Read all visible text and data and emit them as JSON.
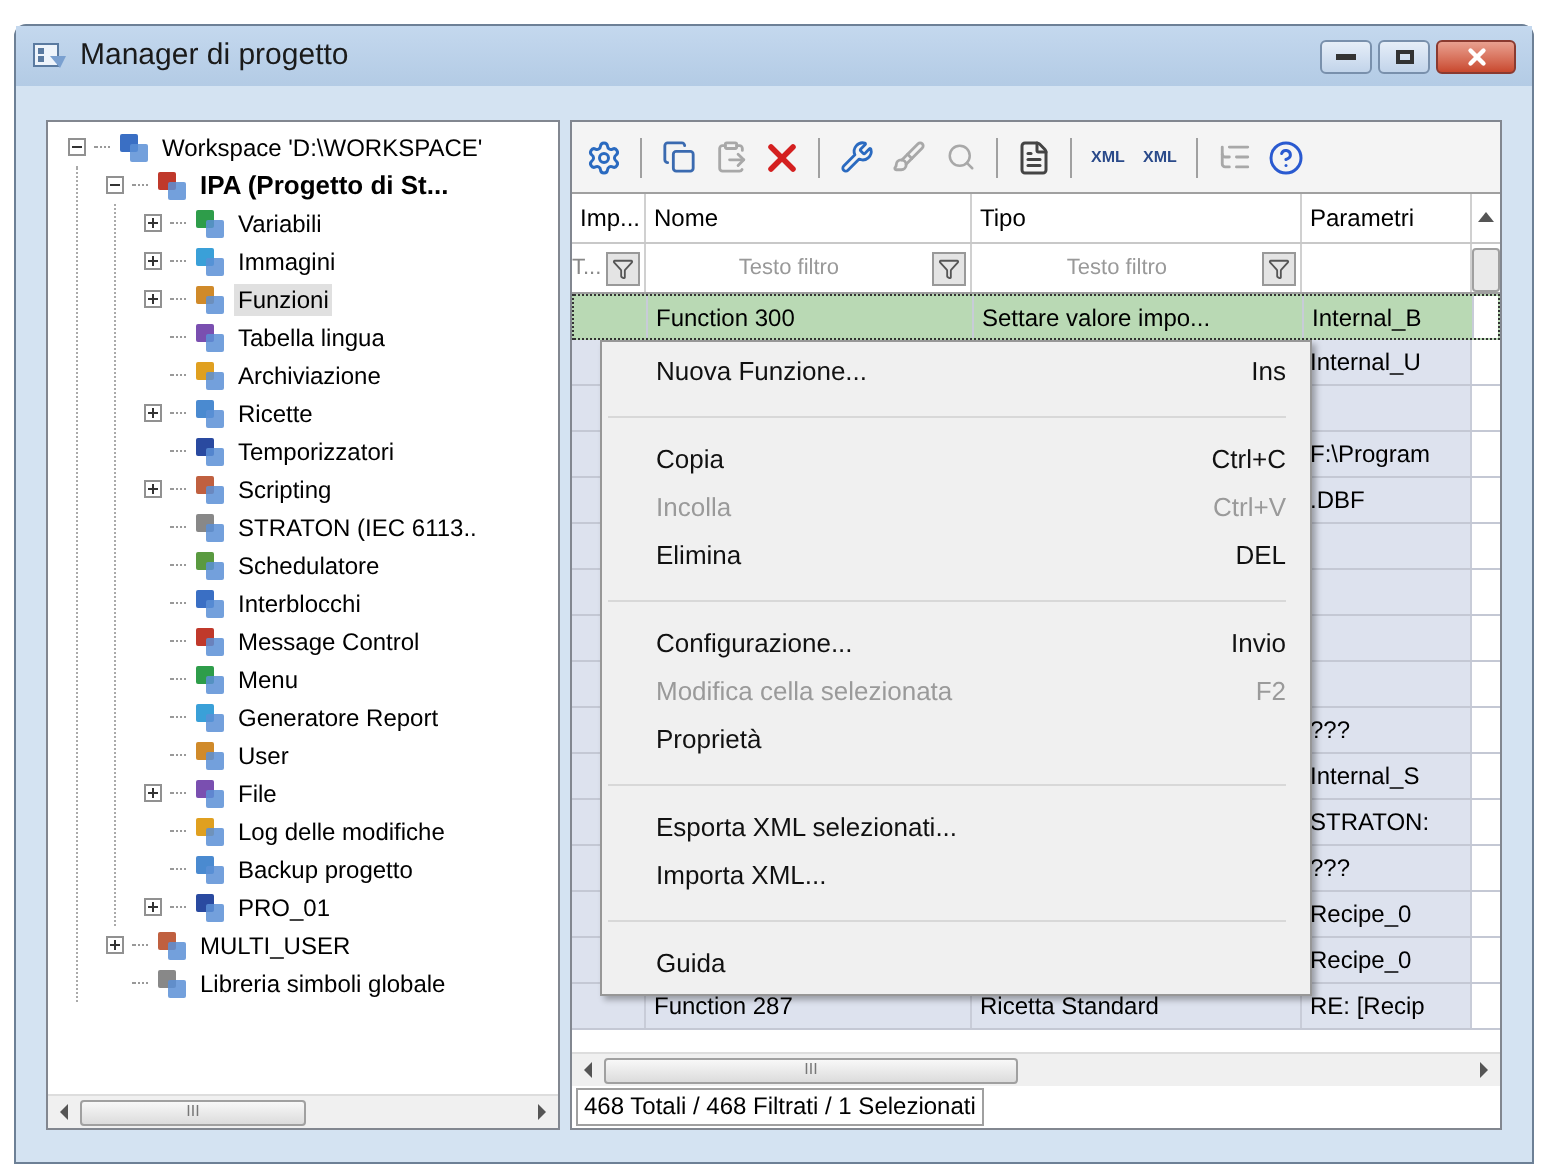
{
  "window": {
    "title": "Manager di progetto"
  },
  "tree": [
    {
      "label": "Workspace 'D:\\WORKSPACE'",
      "expanded": true,
      "selected": false,
      "children": [
        {
          "label": "IPA (Progetto di St...",
          "bold": true,
          "expanded": true,
          "selected": false,
          "children": [
            {
              "label": "Variabili",
              "expanded": false,
              "selected": false
            },
            {
              "label": "Immagini",
              "expanded": false,
              "selected": false
            },
            {
              "label": "Funzioni",
              "expanded": false,
              "selected": true
            },
            {
              "label": "Tabella lingua",
              "selected": false
            },
            {
              "label": "Archiviazione",
              "selected": false
            },
            {
              "label": "Ricette",
              "expanded": false,
              "selected": false
            },
            {
              "label": "Temporizzatori",
              "selected": false
            },
            {
              "label": "Scripting",
              "expanded": false,
              "selected": false
            },
            {
              "label": "STRATON (IEC 6113..",
              "selected": false
            },
            {
              "label": "Schedulatore",
              "selected": false
            },
            {
              "label": "Interblocchi",
              "selected": false
            },
            {
              "label": "Message Control",
              "selected": false
            },
            {
              "label": "Menu",
              "selected": false
            },
            {
              "label": "Generatore Report",
              "selected": false
            },
            {
              "label": "User",
              "selected": false
            },
            {
              "label": "File",
              "expanded": false,
              "selected": false
            },
            {
              "label": "Log delle modifiche",
              "selected": false
            },
            {
              "label": "Backup progetto",
              "selected": false
            },
            {
              "label": "PRO_01",
              "expanded": false,
              "selected": false
            }
          ]
        },
        {
          "label": "MULTI_USER",
          "expanded": false,
          "selected": false
        },
        {
          "label": "Libreria simboli globale",
          "selected": false
        }
      ]
    }
  ],
  "tree_scrollbar": {
    "thumb": "III"
  },
  "toolbar": [
    {
      "kind": "new",
      "disabled": false
    },
    {
      "kind": "separator"
    },
    {
      "kind": "copy",
      "disabled": false
    },
    {
      "kind": "paste",
      "disabled": true
    },
    {
      "kind": "delete",
      "disabled": false
    },
    {
      "kind": "separator"
    },
    {
      "kind": "wrench",
      "disabled": false
    },
    {
      "kind": "brush",
      "disabled": true
    },
    {
      "kind": "find",
      "disabled": true
    },
    {
      "kind": "separator"
    },
    {
      "kind": "properties",
      "disabled": false
    },
    {
      "kind": "separator"
    },
    {
      "kind": "export",
      "label": "XML",
      "disabled": false
    },
    {
      "kind": "import",
      "label": "XML",
      "disabled": false
    },
    {
      "kind": "separator"
    },
    {
      "kind": "tree",
      "disabled": true
    },
    {
      "kind": "help",
      "disabled": false
    }
  ],
  "table": {
    "columns": [
      {
        "label": "Imp...",
        "filter": "T...",
        "funnel": true
      },
      {
        "label": "Nome",
        "placeholder": "Testo filtro",
        "funnel": true
      },
      {
        "label": "Tipo",
        "placeholder": "Testo filtro",
        "funnel": true
      },
      {
        "label": "Parametri"
      }
    ],
    "rows": [
      {
        "selected": true,
        "nome": "Function  300",
        "tipo": "Settare valore impo...",
        "parametri": "Internal_B"
      },
      {
        "selected": false,
        "parametri": "Internal_U"
      },
      {
        "selected": false
      },
      {
        "selected": false,
        "parametri": "F:\\Program"
      },
      {
        "selected": false,
        "parametri": ".DBF"
      },
      {
        "selected": false
      },
      {
        "selected": false
      },
      {
        "selected": false
      },
      {
        "selected": false
      },
      {
        "selected": false,
        "parametri": "???"
      },
      {
        "selected": false,
        "parametri": "Internal_S"
      },
      {
        "selected": false,
        "parametri": "STRATON:"
      },
      {
        "selected": false,
        "parametri": "???"
      },
      {
        "selected": false,
        "parametri": "Recipe_0"
      },
      {
        "selected": false,
        "parametri": "Recipe_0"
      },
      {
        "selected": false,
        "nome": "Function  287",
        "tipo": "Ricetta Standard",
        "parametri": "RE: [Recip"
      }
    ],
    "scrollbar": {
      "thumb": "III"
    }
  },
  "context_menu": [
    {
      "kind": "item",
      "label": "Nuova Funzione...",
      "shortcut": "Ins",
      "disabled": false
    },
    {
      "kind": "separator"
    },
    {
      "kind": "item",
      "label": "Copia",
      "shortcut": "Ctrl+C",
      "disabled": false
    },
    {
      "kind": "item",
      "label": "Incolla",
      "shortcut": "Ctrl+V",
      "disabled": true
    },
    {
      "kind": "item",
      "label": "Elimina",
      "shortcut": "DEL",
      "disabled": false
    },
    {
      "kind": "separator"
    },
    {
      "kind": "item",
      "label": "Configurazione...",
      "shortcut": "Invio",
      "disabled": false
    },
    {
      "kind": "item",
      "label": "Modifica cella selezionata",
      "shortcut": "F2",
      "disabled": true
    },
    {
      "kind": "item",
      "label": "Proprietà",
      "disabled": false
    },
    {
      "kind": "separator"
    },
    {
      "kind": "item",
      "label": "Esporta XML selezionati...",
      "disabled": false
    },
    {
      "kind": "item",
      "label": "Importa XML...",
      "disabled": false
    },
    {
      "kind": "separator"
    },
    {
      "kind": "item",
      "label": "Guida",
      "disabled": false
    }
  ],
  "status_bar": "468 Totali / 468 Filtrati / 1 Selezionati"
}
